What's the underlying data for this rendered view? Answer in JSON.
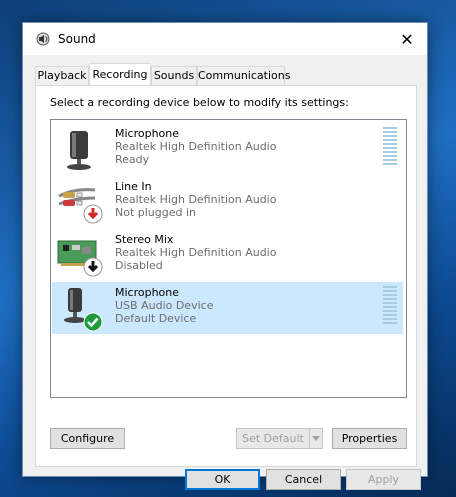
{
  "window": {
    "title": "Sound",
    "close_glyph": "✕"
  },
  "tabs": [
    {
      "label": "Playback"
    },
    {
      "label": "Recording"
    },
    {
      "label": "Sounds"
    },
    {
      "label": "Communications"
    }
  ],
  "active_tab": "Recording",
  "instruction": "Select a recording device below to modify its settings:",
  "devices": [
    {
      "name": "Microphone",
      "driver": "Realtek High Definition Audio",
      "status": "Ready",
      "icon": "microphone-icon",
      "badge": "none"
    },
    {
      "name": "Line In",
      "driver": "Realtek High Definition Audio",
      "status": "Not plugged in",
      "icon": "line-in-cable-icon",
      "badge": "red-down-arrow"
    },
    {
      "name": "Stereo Mix",
      "driver": "Realtek High Definition Audio",
      "status": "Disabled",
      "icon": "sound-card-icon",
      "badge": "black-down-arrow"
    },
    {
      "name": "Microphone",
      "driver": "USB Audio Device",
      "status": "Default Device",
      "icon": "microphone-icon",
      "badge": "green-check"
    }
  ],
  "buttons": {
    "configure": "Configure",
    "set_default": "Set Default",
    "properties": "Properties",
    "ok": "OK",
    "cancel": "Cancel",
    "apply": "Apply"
  },
  "colors": {
    "selection": "#cce8ff",
    "accent": "#0078d7",
    "level_meter": "#a8cbe4"
  }
}
